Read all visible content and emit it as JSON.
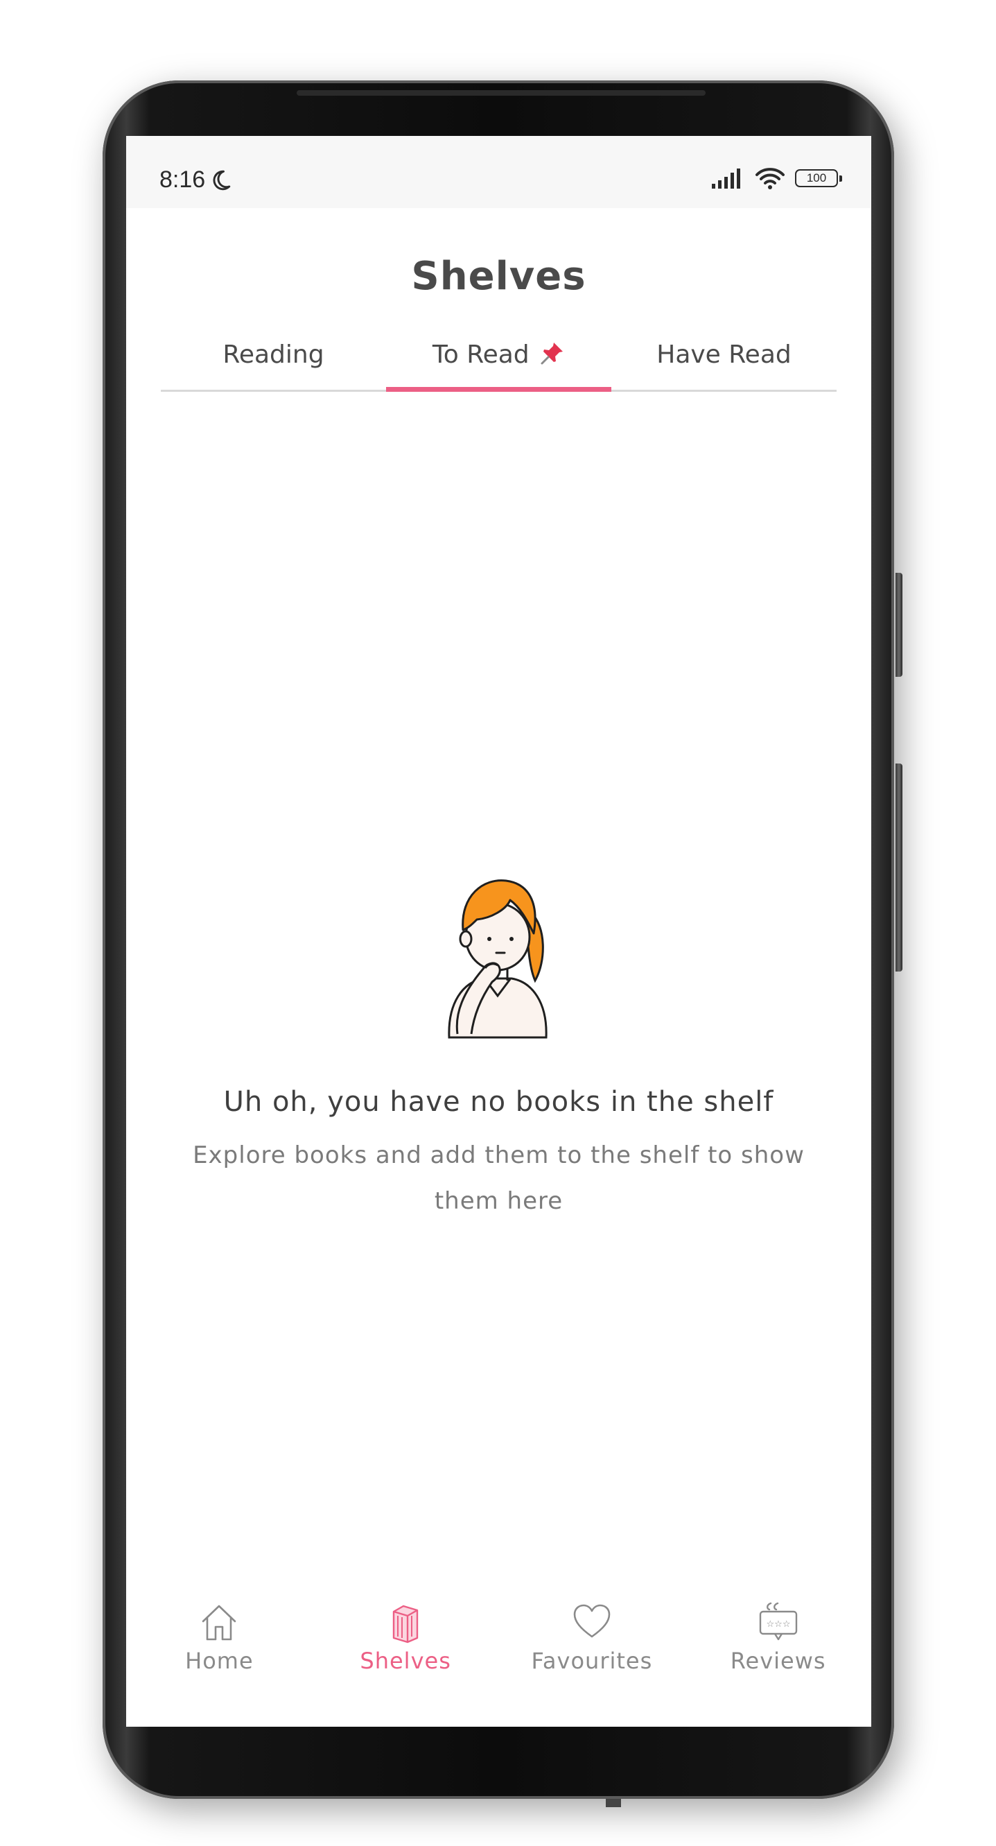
{
  "status_bar": {
    "time": "8:16",
    "battery": "100",
    "icons": [
      "moon-icon",
      "signal-icon",
      "wifi-icon",
      "battery-icon"
    ]
  },
  "header": {
    "title": "Shelves"
  },
  "tabs": [
    {
      "label": "Reading",
      "active": false
    },
    {
      "label": "To Read",
      "icon": "pushpin-icon",
      "active": true
    },
    {
      "label": "Have Read",
      "active": false
    }
  ],
  "empty_state": {
    "title": "Uh oh, you have no books in the shelf",
    "subtitle": "Explore books and add them to the shelf to show them here",
    "illustration": "thinking-girl-illustration"
  },
  "bottom_nav": {
    "items": [
      {
        "label": "Home",
        "icon": "home-icon",
        "active": false
      },
      {
        "label": "Shelves",
        "icon": "bookshelf-icon",
        "active": true
      },
      {
        "label": "Favourites",
        "icon": "heart-icon",
        "active": false
      },
      {
        "label": "Reviews",
        "icon": "reviews-icon",
        "active": false
      }
    ]
  },
  "colors": {
    "accent": "#ec5f85",
    "text_primary": "#4a4a4a",
    "text_secondary": "#7a7a7a",
    "illustration_hair": "#f7941d"
  }
}
